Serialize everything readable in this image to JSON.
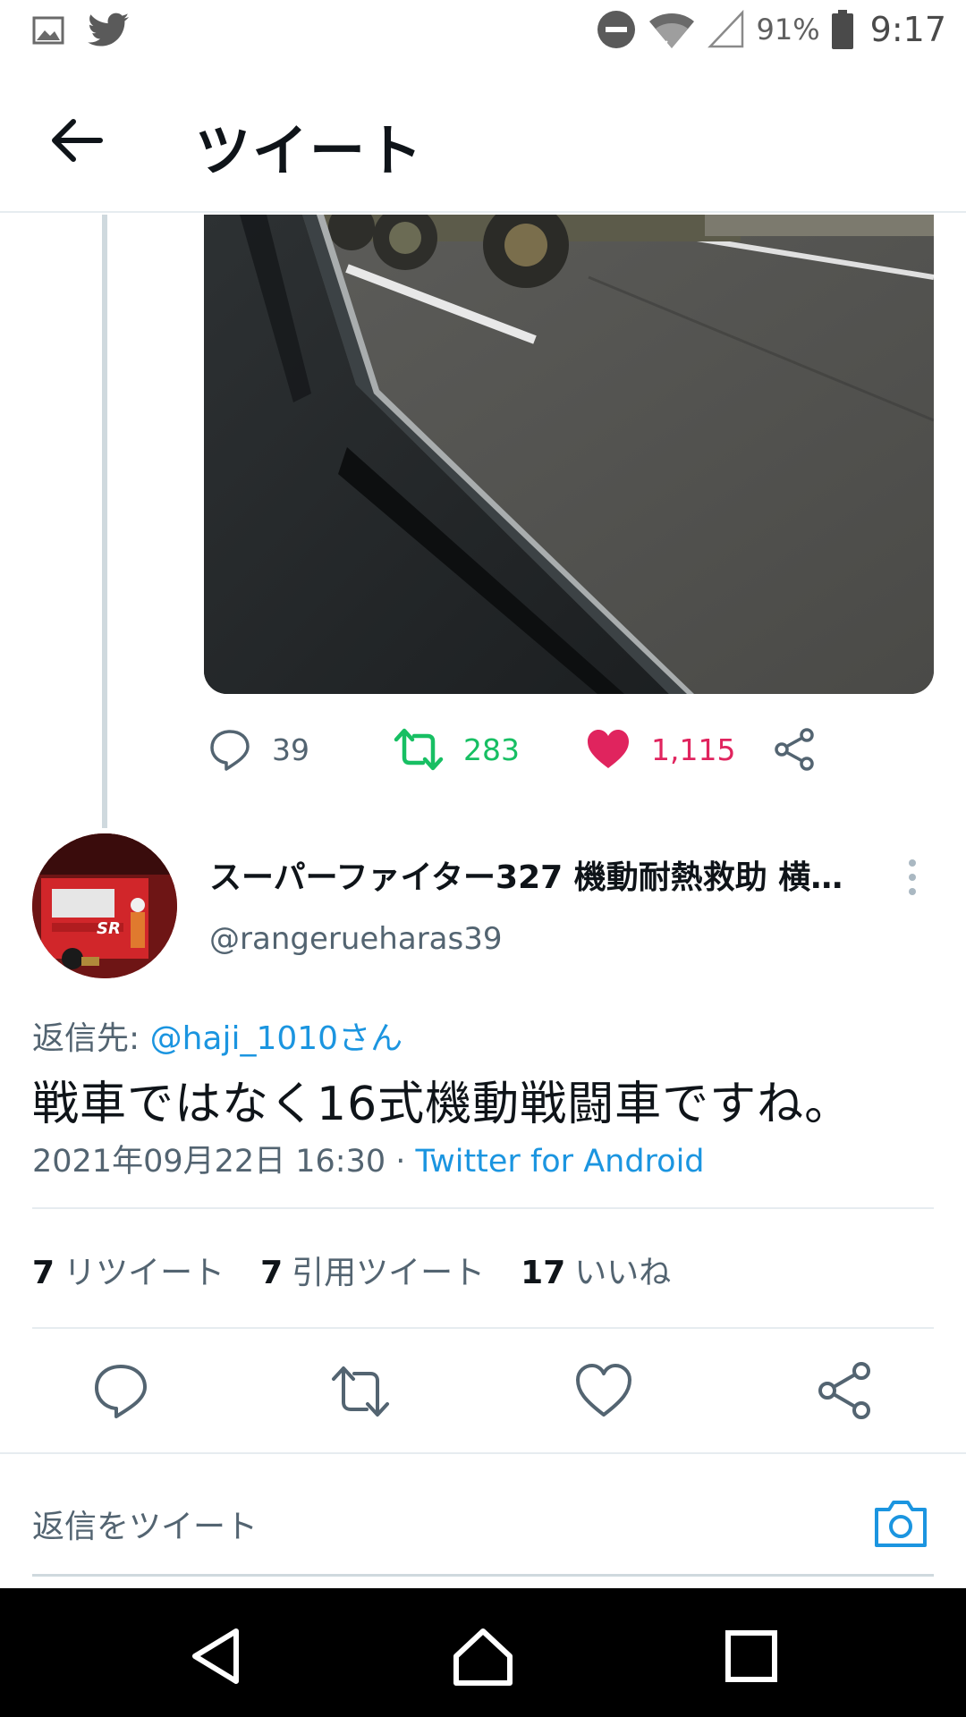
{
  "status_bar": {
    "battery": "91%",
    "time": "9:17"
  },
  "header": {
    "title": "ツイート"
  },
  "previous_tweet": {
    "reply_count": "39",
    "retweet_count": "283",
    "like_count": "1,115"
  },
  "tweet": {
    "author_name": "スーパーファイター327 機動耐熱救助 横…",
    "author_handle": "@rangerueharas39",
    "reply_to_prefix": "返信先: ",
    "reply_to_mention": "@haji_1010さん",
    "text": "戦車ではなく16式機動戦闘車ですね。",
    "timestamp": "2021年09月22日 16:30 · ",
    "source": "Twitter for Android",
    "retweets_count": "7",
    "retweets_label": "リツイート",
    "quotes_count": "7",
    "quotes_label": "引用ツイート",
    "likes_count": "17",
    "likes_label": "いいね"
  },
  "reply_bar": {
    "placeholder": "返信をツイート"
  },
  "colors": {
    "retweet": "#17bf63",
    "like": "#e0245e",
    "link": "#1b95e0"
  }
}
